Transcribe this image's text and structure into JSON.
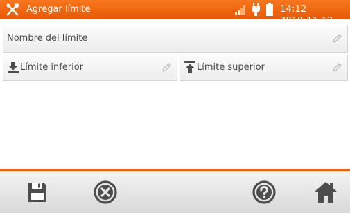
{
  "header": {
    "title": "Agregar límite",
    "datetime": "14:12 2019.11.12",
    "icons": [
      "tools-icon",
      "signal-icon",
      "plug-icon",
      "battery-icon"
    ]
  },
  "form": {
    "name_field": {
      "label": "Nombre del límite",
      "icon": "pencil-icon"
    },
    "lower_limit": {
      "label": "Límite inferior",
      "icon": "download-arrow-icon"
    },
    "upper_limit": {
      "label": "Límite superior",
      "icon": "upload-arrow-icon"
    }
  },
  "bottom_bar": {
    "buttons": [
      "save-icon",
      "cancel-icon",
      "help-icon",
      "home-icon"
    ]
  },
  "colors": {
    "accent": "#f26b12",
    "icon": "#4d4d4d",
    "field_bg": "#f3f3f3",
    "text": "#4a4a4a"
  }
}
